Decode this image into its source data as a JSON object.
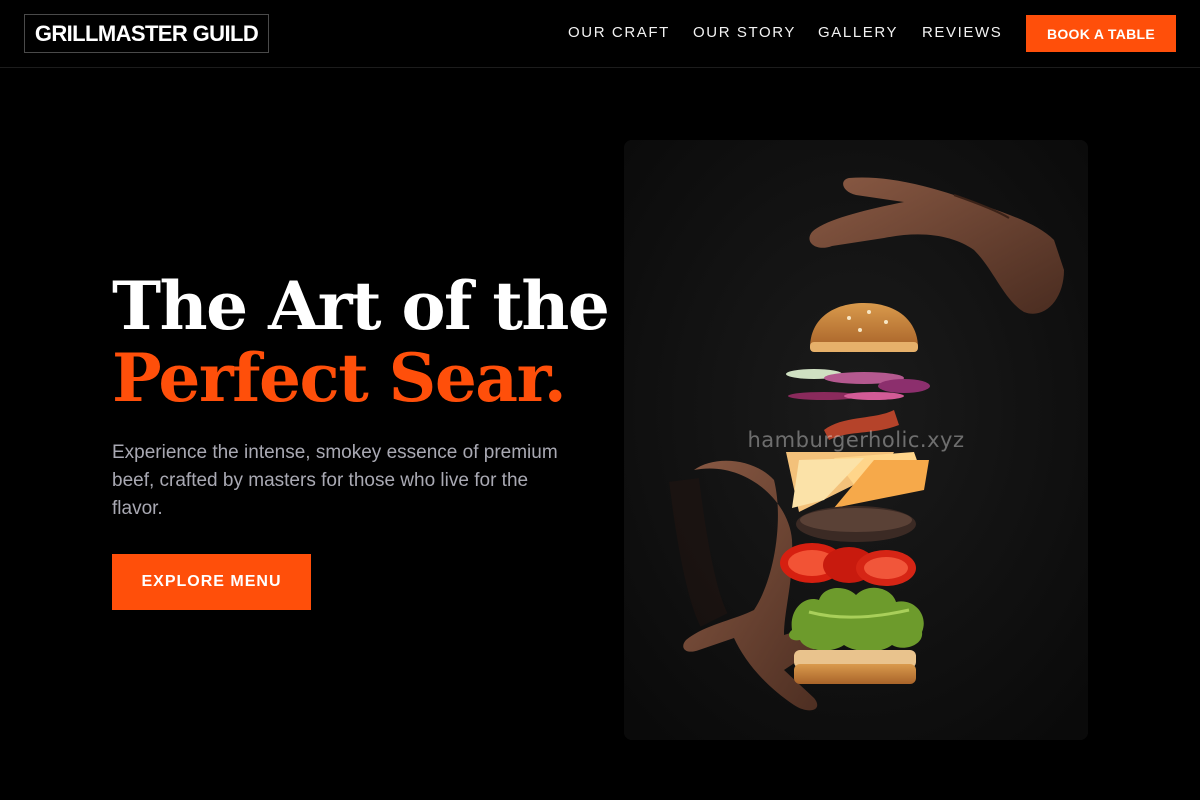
{
  "header": {
    "brand": "GRILLMASTER GUILD",
    "nav": [
      "OUR CRAFT",
      "OUR STORY",
      "GALLERY",
      "REVIEWS"
    ],
    "cta_label": "BOOK A TABLE"
  },
  "hero": {
    "headline_line1": "The Art of the",
    "headline_line2": "Perfect Sear.",
    "lead": "Experience the intense, smokey essence of premium beef, crafted by masters for those who live for the flavor.",
    "cta_label": "EXPLORE MENU"
  },
  "photo": {
    "watermark": "hamburgerholic.xyz",
    "subject": "floating-burger-photo"
  },
  "colors": {
    "accent": "#ff4f0a",
    "background": "#000000",
    "lead_text": "#a9a9b3"
  }
}
